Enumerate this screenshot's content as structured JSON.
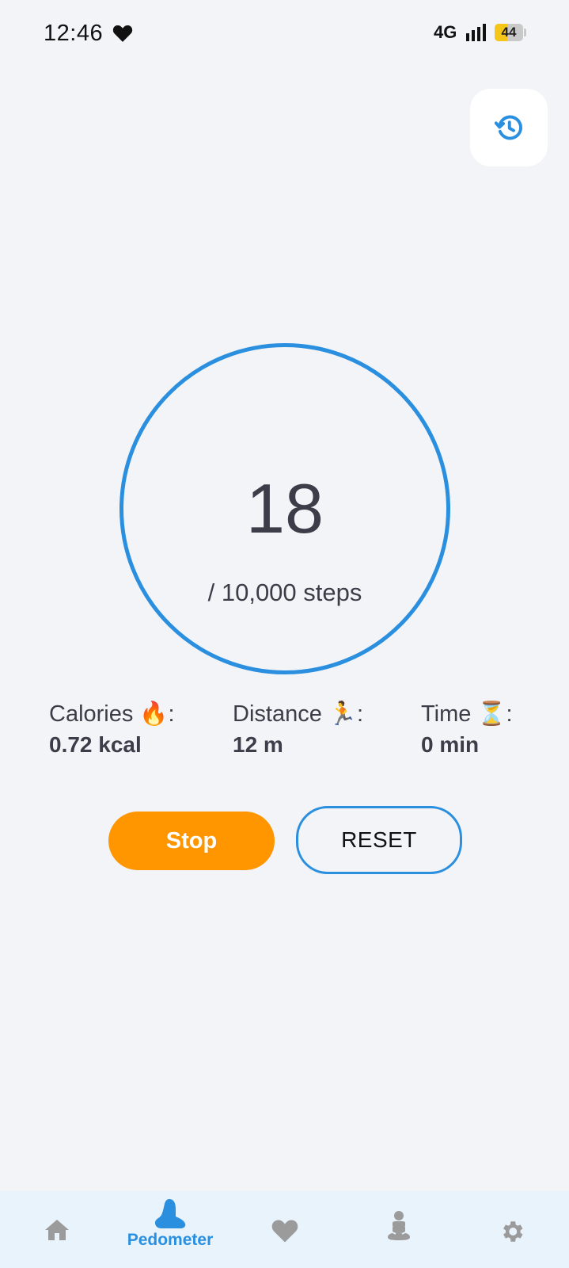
{
  "status_bar": {
    "time": "12:46",
    "network": "4G",
    "battery_level": "44",
    "battery_fraction": 0.44
  },
  "header": {
    "history_icon": "history-icon"
  },
  "steps": {
    "count": "18",
    "goal_text": "/ 10,000 steps"
  },
  "stats": {
    "calories": {
      "label": "Calories 🔥:",
      "value": "0.72 kcal"
    },
    "distance": {
      "label": "Distance 🏃:",
      "value": "12 m"
    },
    "time": {
      "label": "Time ⏳:",
      "value": "0 min"
    }
  },
  "actions": {
    "stop_label": "Stop",
    "reset_label": "RESET"
  },
  "nav": {
    "items": [
      {
        "icon": "home-icon"
      },
      {
        "icon": "foot-icon",
        "label": "Pedometer",
        "active": true
      },
      {
        "icon": "heart-icon"
      },
      {
        "icon": "meditation-icon"
      },
      {
        "icon": "gear-icon"
      }
    ]
  },
  "colors": {
    "accent": "#2b8fe0",
    "stop": "#ff9600",
    "background": "#f2f4f7",
    "nav_background": "#e8f3fc",
    "inactive_icon": "#9b9b9b"
  }
}
